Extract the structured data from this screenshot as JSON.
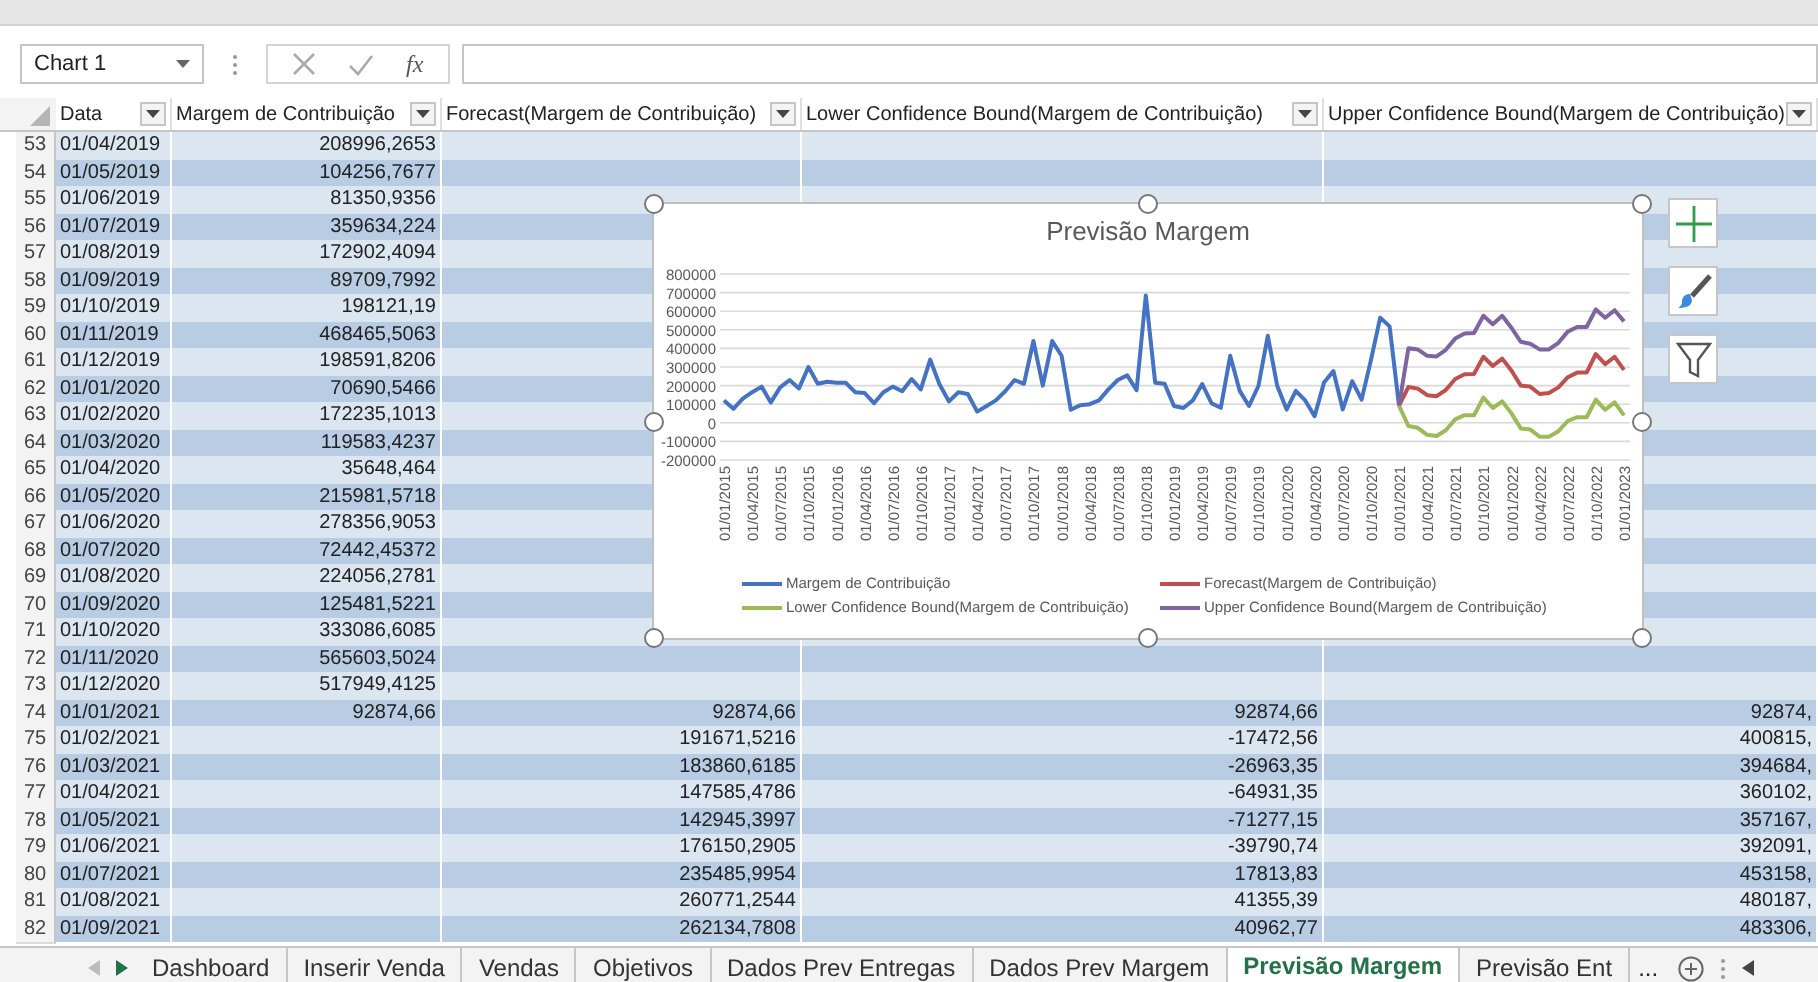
{
  "formula_bar": {
    "name_box": "Chart 1",
    "fx": "fx"
  },
  "table": {
    "columns": [
      {
        "label": "Data"
      },
      {
        "label": "Margem de Contribuição"
      },
      {
        "label": "Forecast(Margem de Contribuição)"
      },
      {
        "label": "Lower Confidence Bound(Margem de Contribuição)"
      },
      {
        "label": "Upper Confidence Bound(Margem de Contribuição)"
      }
    ],
    "rows": [
      {
        "row": "53",
        "data": "01/04/2019",
        "margem": "208996,2653"
      },
      {
        "row": "54",
        "data": "01/05/2019",
        "margem": "104256,7677"
      },
      {
        "row": "55",
        "data": "01/06/2019",
        "margem": "81350,9356"
      },
      {
        "row": "56",
        "data": "01/07/2019",
        "margem": "359634,224"
      },
      {
        "row": "57",
        "data": "01/08/2019",
        "margem": "172902,4094"
      },
      {
        "row": "58",
        "data": "01/09/2019",
        "margem": "89709,7992"
      },
      {
        "row": "59",
        "data": "01/10/2019",
        "margem": "198121,19"
      },
      {
        "row": "60",
        "data": "01/11/2019",
        "margem": "468465,5063"
      },
      {
        "row": "61",
        "data": "01/12/2019",
        "margem": "198591,8206"
      },
      {
        "row": "62",
        "data": "01/01/2020",
        "margem": "70690,5466"
      },
      {
        "row": "63",
        "data": "01/02/2020",
        "margem": "172235,1013"
      },
      {
        "row": "64",
        "data": "01/03/2020",
        "margem": "119583,4237"
      },
      {
        "row": "65",
        "data": "01/04/2020",
        "margem": "35648,464"
      },
      {
        "row": "66",
        "data": "01/05/2020",
        "margem": "215981,5718"
      },
      {
        "row": "67",
        "data": "01/06/2020",
        "margem": "278356,9053"
      },
      {
        "row": "68",
        "data": "01/07/2020",
        "margem": "72442,45372"
      },
      {
        "row": "69",
        "data": "01/08/2020",
        "margem": "224056,2781"
      },
      {
        "row": "70",
        "data": "01/09/2020",
        "margem": "125481,5221"
      },
      {
        "row": "71",
        "data": "01/10/2020",
        "margem": "333086,6085"
      },
      {
        "row": "72",
        "data": "01/11/2020",
        "margem": "565603,5024"
      },
      {
        "row": "73",
        "data": "01/12/2020",
        "margem": "517949,4125"
      },
      {
        "row": "74",
        "data": "01/01/2021",
        "margem": "92874,66",
        "forecast": "92874,66",
        "lower": "92874,66",
        "upper": "92874,"
      },
      {
        "row": "75",
        "data": "01/02/2021",
        "forecast": "191671,5216",
        "lower": "-17472,56",
        "upper": "400815,"
      },
      {
        "row": "76",
        "data": "01/03/2021",
        "forecast": "183860,6185",
        "lower": "-26963,35",
        "upper": "394684,"
      },
      {
        "row": "77",
        "data": "01/04/2021",
        "forecast": "147585,4786",
        "lower": "-64931,35",
        "upper": "360102,"
      },
      {
        "row": "78",
        "data": "01/05/2021",
        "forecast": "142945,3997",
        "lower": "-71277,15",
        "upper": "357167,"
      },
      {
        "row": "79",
        "data": "01/06/2021",
        "forecast": "176150,2905",
        "lower": "-39790,74",
        "upper": "392091,"
      },
      {
        "row": "80",
        "data": "01/07/2021",
        "forecast": "235485,9954",
        "lower": "17813,83",
        "upper": "453158,"
      },
      {
        "row": "81",
        "data": "01/08/2021",
        "forecast": "260771,2544",
        "lower": "41355,39",
        "upper": "480187,"
      },
      {
        "row": "82",
        "data": "01/09/2021",
        "forecast": "262134,7808",
        "lower": "40962,77",
        "upper": "483306,"
      }
    ]
  },
  "chart": {
    "chart_data": {
      "type": "line",
      "title": "Previsão Margem",
      "grid": true,
      "legend": true,
      "categories": [
        "01/01/2015",
        null,
        null,
        "01/04/2015",
        null,
        null,
        "01/07/2015",
        null,
        null,
        "01/10/2015",
        null,
        null,
        "01/01/2016",
        null,
        null,
        "01/04/2016",
        null,
        null,
        "01/07/2016",
        null,
        null,
        "01/10/2016",
        null,
        null,
        "01/01/2017",
        null,
        null,
        "01/04/2017",
        null,
        null,
        "01/07/2017",
        null,
        null,
        "01/10/2017",
        null,
        null,
        "01/01/2018",
        null,
        null,
        "01/04/2018",
        null,
        null,
        "01/07/2018",
        null,
        null,
        "01/10/2018",
        null,
        null,
        "01/01/2019",
        null,
        null,
        "01/04/2019",
        null,
        null,
        "01/07/2019",
        null,
        null,
        "01/10/2019",
        null,
        null,
        "01/01/2020",
        null,
        null,
        "01/04/2020",
        null,
        null,
        "01/07/2020",
        null,
        null,
        "01/10/2020",
        null,
        null,
        "01/01/2021",
        null,
        null,
        "01/04/2021",
        null,
        null,
        "01/07/2021",
        null,
        null,
        "01/10/2021",
        null,
        null,
        "01/01/2022",
        null,
        null,
        "01/04/2022",
        null,
        null,
        "01/07/2022",
        null,
        null,
        "01/10/2022",
        null,
        null,
        "01/01/2023"
      ],
      "ylim": [
        -200000,
        800000
      ],
      "yticks": [
        -200000,
        -100000,
        0,
        100000,
        200000,
        300000,
        400000,
        500000,
        600000,
        700000,
        800000
      ],
      "series": [
        {
          "name": "Margem de Contribuição",
          "color": "#4472c4",
          "values": [
            120000,
            75000,
            130000,
            165000,
            195000,
            110000,
            190000,
            230000,
            185000,
            300000,
            210000,
            220000,
            215000,
            215000,
            165000,
            160000,
            105000,
            165000,
            195000,
            170000,
            235000,
            180000,
            340000,
            205000,
            115000,
            165000,
            155000,
            60000,
            90000,
            120000,
            170000,
            230000,
            210000,
            440000,
            200000,
            440000,
            360000,
            70000,
            95000,
            100000,
            120000,
            180000,
            230000,
            255000,
            175000,
            685000,
            215000,
            210000,
            90000,
            80000,
            120000,
            209000,
            104000,
            81000,
            360000,
            173000,
            90000,
            198000,
            468000,
            199000,
            71000,
            172000,
            120000,
            36000,
            216000,
            278000,
            72000,
            224000,
            125000,
            333000,
            566000,
            518000,
            93000,
            null,
            null,
            null,
            null,
            null,
            null,
            null,
            null,
            null,
            null,
            null,
            null,
            null,
            null,
            null,
            null,
            null,
            null,
            null,
            null,
            null,
            null,
            null,
            null
          ]
        },
        {
          "name": "Forecast(Margem de Contribuição)",
          "color": "#c0504d",
          "values": [
            null,
            null,
            null,
            null,
            null,
            null,
            null,
            null,
            null,
            null,
            null,
            null,
            null,
            null,
            null,
            null,
            null,
            null,
            null,
            null,
            null,
            null,
            null,
            null,
            null,
            null,
            null,
            null,
            null,
            null,
            null,
            null,
            null,
            null,
            null,
            null,
            null,
            null,
            null,
            null,
            null,
            null,
            null,
            null,
            null,
            null,
            null,
            null,
            null,
            null,
            null,
            null,
            null,
            null,
            null,
            null,
            null,
            null,
            null,
            null,
            null,
            null,
            null,
            null,
            null,
            null,
            null,
            null,
            null,
            null,
            null,
            null,
            93000,
            192000,
            184000,
            148000,
            143000,
            176000,
            235000,
            261000,
            262000,
            355000,
            305000,
            345000,
            280000,
            200000,
            195000,
            155000,
            160000,
            190000,
            245000,
            270000,
            270000,
            370000,
            315000,
            355000,
            285000
          ]
        },
        {
          "name": "Lower Confidence Bound(Margem de Contribuição)",
          "color": "#9bbb59",
          "values": [
            null,
            null,
            null,
            null,
            null,
            null,
            null,
            null,
            null,
            null,
            null,
            null,
            null,
            null,
            null,
            null,
            null,
            null,
            null,
            null,
            null,
            null,
            null,
            null,
            null,
            null,
            null,
            null,
            null,
            null,
            null,
            null,
            null,
            null,
            null,
            null,
            null,
            null,
            null,
            null,
            null,
            null,
            null,
            null,
            null,
            null,
            null,
            null,
            null,
            null,
            null,
            null,
            null,
            null,
            null,
            null,
            null,
            null,
            null,
            null,
            null,
            null,
            null,
            null,
            null,
            null,
            null,
            null,
            null,
            null,
            null,
            null,
            93000,
            -17000,
            -27000,
            -65000,
            -71000,
            -40000,
            18000,
            41000,
            41000,
            135000,
            80000,
            115000,
            50000,
            -30000,
            -35000,
            -75000,
            -75000,
            -45000,
            10000,
            30000,
            30000,
            125000,
            70000,
            110000,
            40000
          ]
        },
        {
          "name": "Upper Confidence Bound(Margem de Contribuição)",
          "color": "#8064a2",
          "values": [
            null,
            null,
            null,
            null,
            null,
            null,
            null,
            null,
            null,
            null,
            null,
            null,
            null,
            null,
            null,
            null,
            null,
            null,
            null,
            null,
            null,
            null,
            null,
            null,
            null,
            null,
            null,
            null,
            null,
            null,
            null,
            null,
            null,
            null,
            null,
            null,
            null,
            null,
            null,
            null,
            null,
            null,
            null,
            null,
            null,
            null,
            null,
            null,
            null,
            null,
            null,
            null,
            null,
            null,
            null,
            null,
            null,
            null,
            null,
            null,
            null,
            null,
            null,
            null,
            null,
            null,
            null,
            null,
            null,
            null,
            null,
            null,
            93000,
            401000,
            395000,
            360000,
            357000,
            392000,
            453000,
            480000,
            483000,
            575000,
            530000,
            575000,
            510000,
            435000,
            425000,
            395000,
            395000,
            430000,
            490000,
            515000,
            515000,
            610000,
            565000,
            605000,
            545000
          ]
        }
      ]
    }
  },
  "sheet_tabs": [
    {
      "label": "Dashboard",
      "selected": false
    },
    {
      "label": "Inserir Venda",
      "selected": false
    },
    {
      "label": "Vendas",
      "selected": false
    },
    {
      "label": "Objetivos",
      "selected": false
    },
    {
      "label": "Dados Prev Entregas",
      "selected": false
    },
    {
      "label": "Dados Prev Margem",
      "selected": false
    },
    {
      "label": "Previsão Margem",
      "selected": true
    },
    {
      "label": "Previsão Ent",
      "selected": false
    }
  ],
  "more_tabs": "..."
}
